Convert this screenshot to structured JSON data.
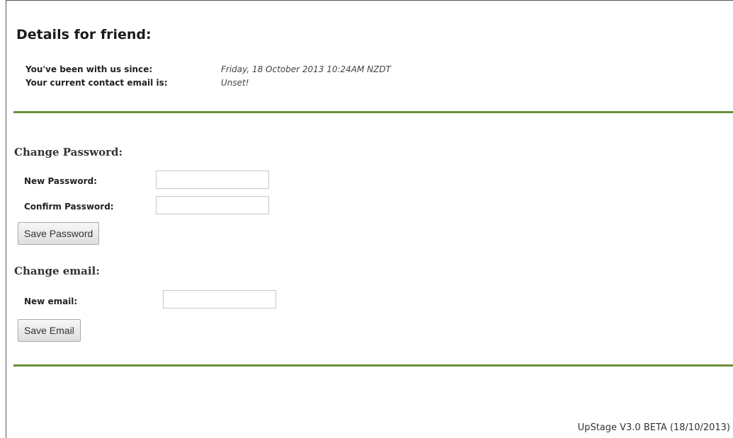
{
  "page": {
    "title": "Details for friend:"
  },
  "details": {
    "member_since_label": "You've been with us since:",
    "member_since_value": "Friday, 18 October 2013 10:24AM NZDT",
    "contact_email_label": "Your current contact email is:",
    "contact_email_value": "Unset!"
  },
  "password_section": {
    "title": "Change Password:",
    "new_password_label": "New Password:",
    "new_password_value": "",
    "confirm_password_label": "Confirm Password:",
    "confirm_password_value": "",
    "save_button_label": "Save Password"
  },
  "email_section": {
    "title": "Change email:",
    "new_email_label": "New email:",
    "new_email_value": "",
    "save_button_label": "Save Email"
  },
  "footer": {
    "version_text": "UpStage V3.0 BETA (18/10/2013)"
  },
  "colors": {
    "divider": "#6b8e3a"
  }
}
